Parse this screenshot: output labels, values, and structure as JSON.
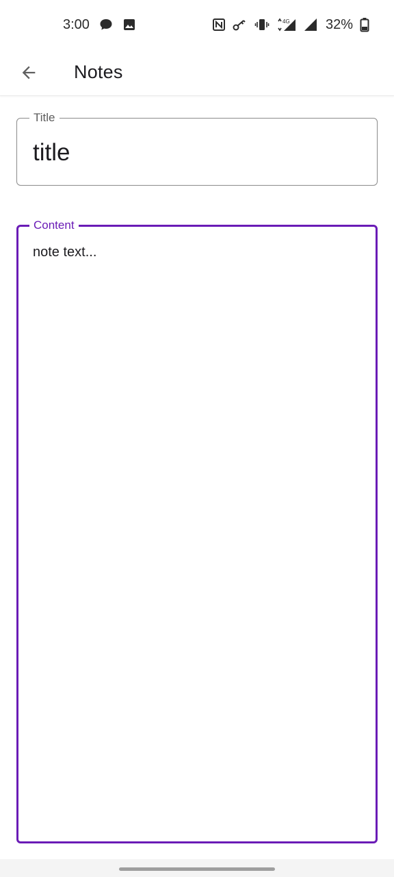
{
  "status_bar": {
    "time": "3:00",
    "left_icons": [
      "message-icon",
      "image-icon"
    ],
    "right_icons": [
      "nfc-icon",
      "vpn-key-icon",
      "vibrate-icon",
      "network-4g-icon",
      "signal-icon",
      "battery-icon"
    ],
    "network_type": "4G",
    "battery_percent": "32%"
  },
  "app_bar": {
    "title": "Notes",
    "back_icon": "arrow-back-icon"
  },
  "form": {
    "title_field": {
      "label": "Title",
      "value": "title"
    },
    "content_field": {
      "label": "Content",
      "value": "note text..."
    }
  },
  "colors": {
    "accent": "#6a1bb6",
    "outline": "#8a8a8a",
    "text": "#1c1b1f"
  }
}
